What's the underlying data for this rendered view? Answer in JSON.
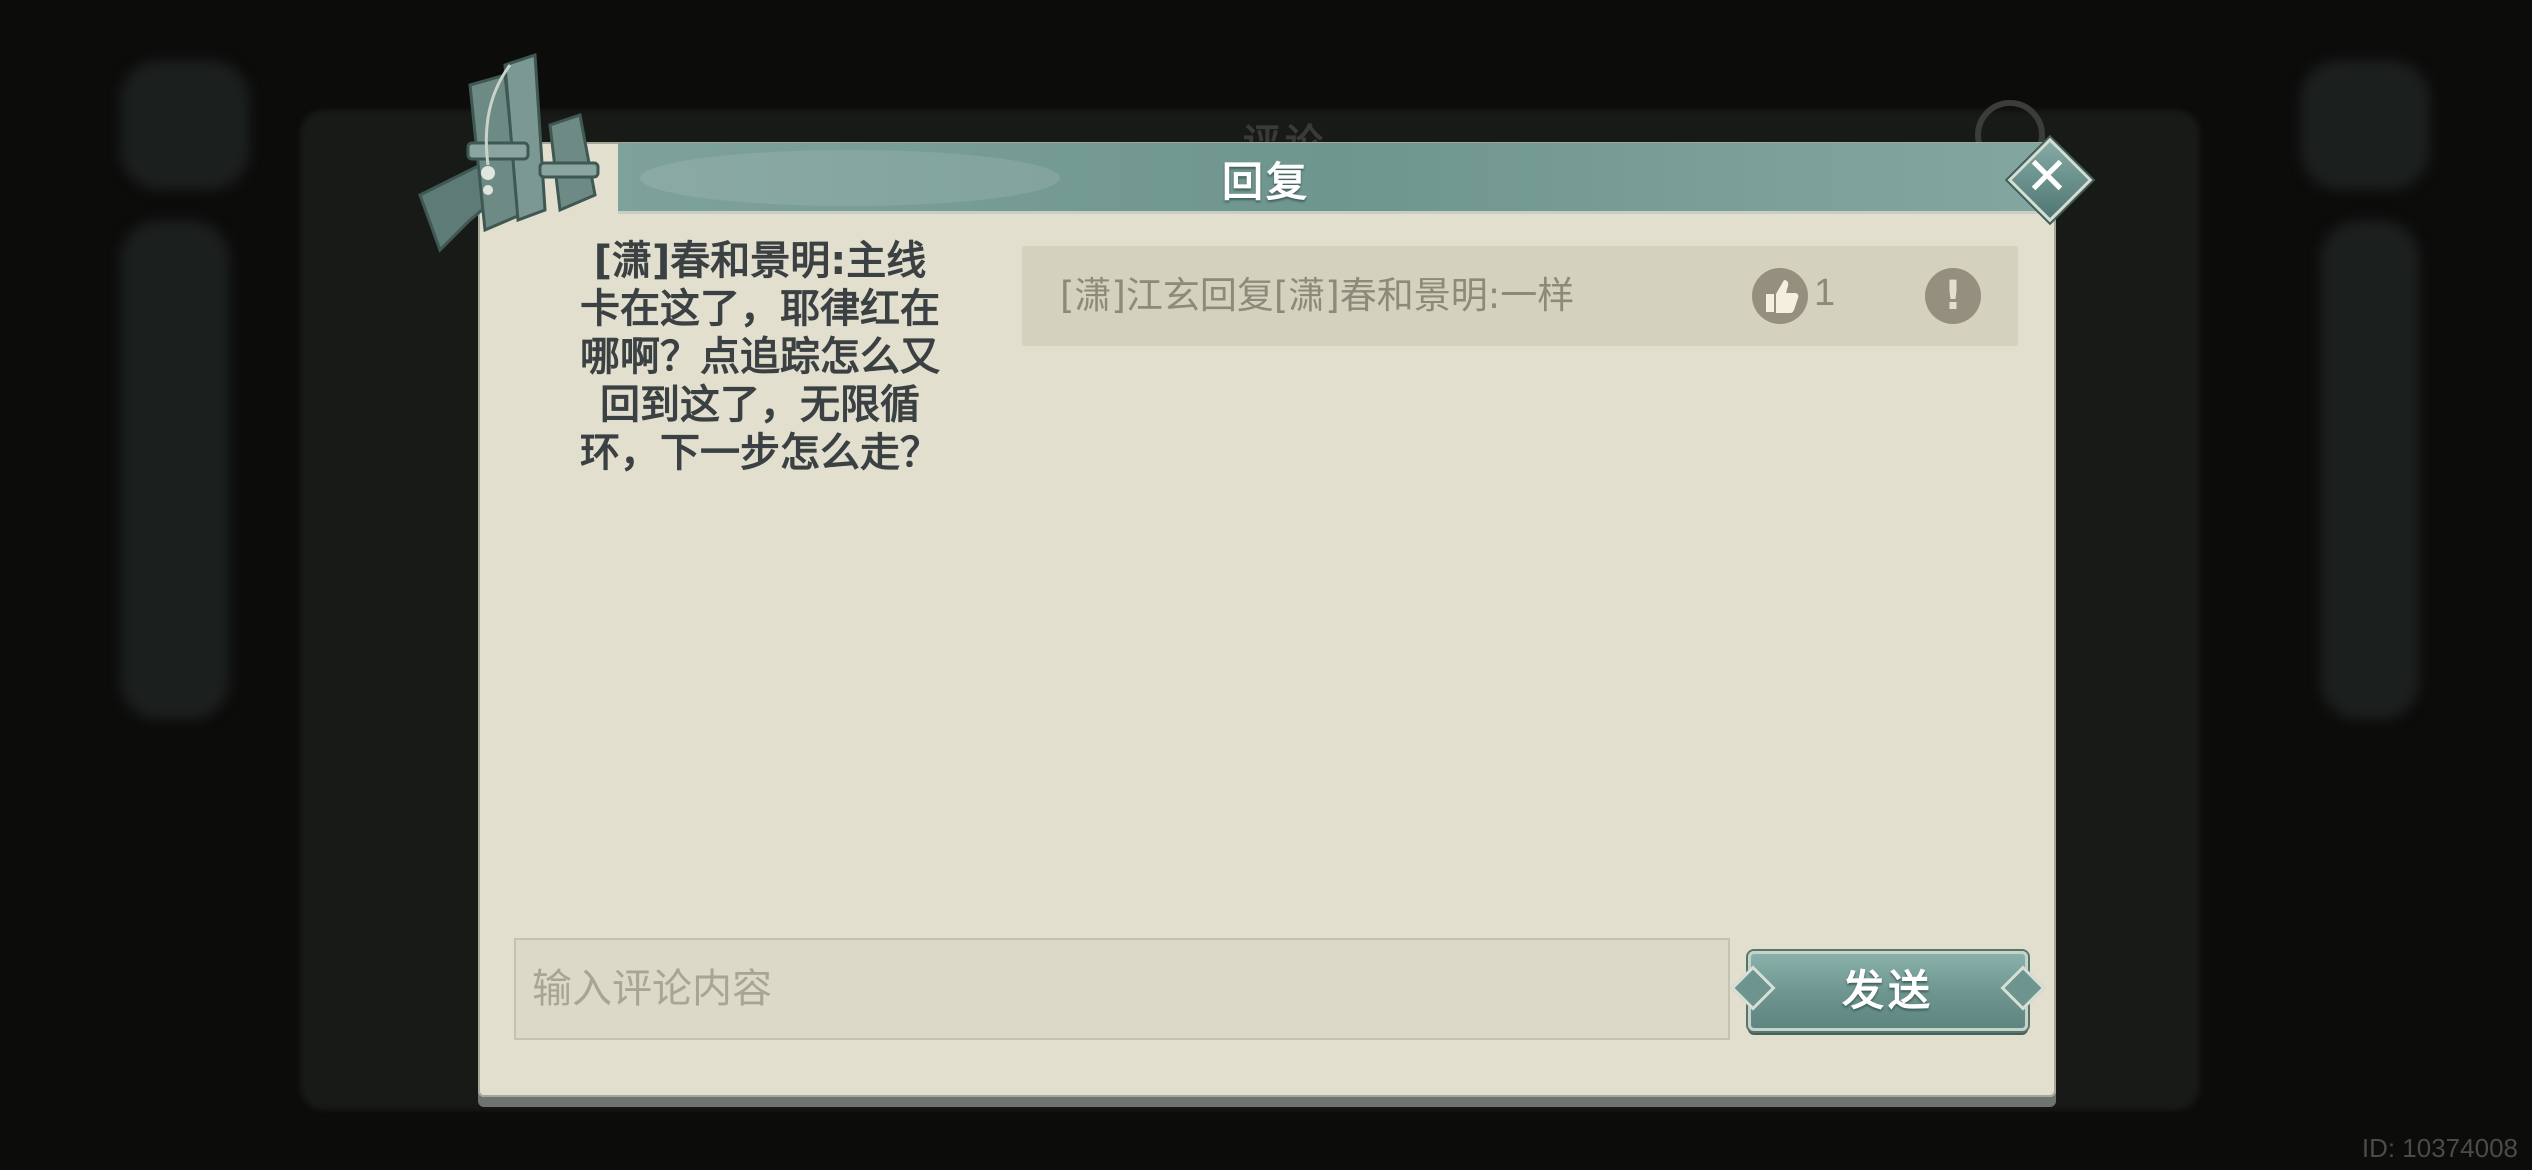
{
  "background": {
    "old_title": "评论",
    "watermark": "ID: 10374008"
  },
  "dialog": {
    "title": "回复",
    "close_icon": "close-icon"
  },
  "main_comment": {
    "text": "[潇]春和景明:主线卡在这了，耶律红在哪啊？点追踪怎么又回到这了，无限循环，下一步怎么走？"
  },
  "replies": [
    {
      "text": "[潇]江玄回复[潇]春和景明:一样",
      "likes": "1",
      "like_icon": "thumbs-up-icon",
      "report_icon": "exclamation-icon",
      "report_glyph": "!"
    }
  ],
  "composer": {
    "placeholder": "输入评论内容",
    "value": "",
    "send_label": "发送"
  },
  "colors": {
    "accent_teal": "#6f958f",
    "panel_bg": "#e2dfcf",
    "row_bg": "#d4d1bf",
    "muted_text": "#8d8a79"
  }
}
